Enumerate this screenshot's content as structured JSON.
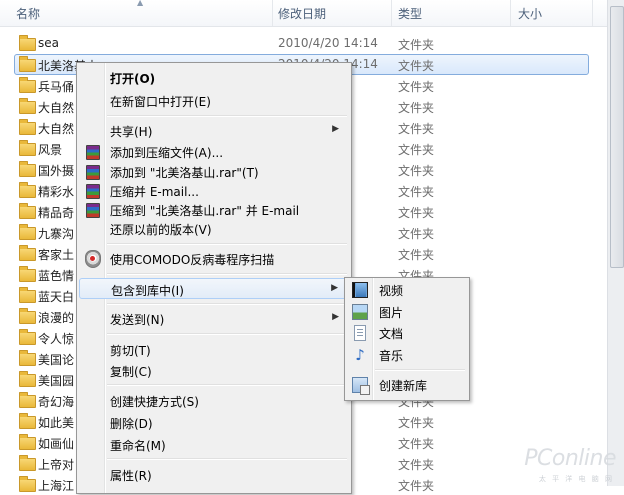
{
  "header": {
    "columns": [
      "名称",
      "修改日期",
      "类型",
      "大小"
    ]
  },
  "files": [
    {
      "name": "sea",
      "date": "2010/4/20 14:14",
      "type": "文件夹",
      "selected": false
    },
    {
      "name": "北美洛基山",
      "date": "2010/4/20 14:14",
      "type": "文件夹",
      "selected": true
    },
    {
      "name": "兵马俑",
      "date": "14:14",
      "type": "文件夹",
      "selected": false
    },
    {
      "name": "大自然",
      "date": "14:14",
      "type": "文件夹",
      "selected": false
    },
    {
      "name": "大自然",
      "date": "8:07",
      "type": "文件夹",
      "selected": false
    },
    {
      "name": "风景",
      "date": "14:14",
      "type": "文件夹",
      "selected": false
    },
    {
      "name": "国外摄",
      "date": "14:14",
      "type": "文件夹",
      "selected": false
    },
    {
      "name": "精彩水",
      "date": "14:14",
      "type": "文件夹",
      "selected": false
    },
    {
      "name": "精品奇",
      "date": "14:14",
      "type": "文件夹",
      "selected": false
    },
    {
      "name": "九寨沟",
      "date": "14:14",
      "type": "文件夹",
      "selected": false
    },
    {
      "name": "客家土",
      "date": "14:14",
      "type": "文件夹",
      "selected": false
    },
    {
      "name": "蓝色情",
      "date": "14:14",
      "type": "文件夹",
      "selected": false
    },
    {
      "name": "蓝天白",
      "date": "14:14",
      "type": "文件夹",
      "selected": false
    },
    {
      "name": "浪漫的",
      "date": "14:14",
      "type": "文件夹",
      "selected": false
    },
    {
      "name": "令人惊",
      "date": "14:14",
      "type": "文件夹",
      "selected": false
    },
    {
      "name": "美国论",
      "date": "14:14",
      "type": "文件夹",
      "selected": false
    },
    {
      "name": "美国园",
      "date": "14:14",
      "type": "文件夹",
      "selected": false
    },
    {
      "name": "奇幻海",
      "date": "14:14",
      "type": "文件夹",
      "selected": false
    },
    {
      "name": "如此美",
      "date": "14:14",
      "type": "文件夹",
      "selected": false
    },
    {
      "name": "如画仙",
      "date": "14:14",
      "type": "文件夹",
      "selected": false
    },
    {
      "name": "上帝对",
      "date": "14:14",
      "type": "文件夹",
      "selected": false
    },
    {
      "name": "上海江",
      "date": "14:14",
      "type": "文件夹",
      "selected": false
    }
  ],
  "context_menu": {
    "open": "打开(O)",
    "open_new_window": "在新窗口中打开(E)",
    "share": "共享(H)",
    "add_to_archive": "添加到压缩文件(A)...",
    "add_to_rar": "添加到 \"北美洛基山.rar\"(T)",
    "compress_email": "压缩并 E-mail...",
    "compress_rar_email": "压缩到 \"北美洛基山.rar\" 并 E-mail",
    "restore_previous": "还原以前的版本(V)",
    "comodo_scan": "使用COMODO反病毒程序扫描",
    "include_in_library": "包含到库中(I)",
    "send_to": "发送到(N)",
    "cut": "剪切(T)",
    "copy": "复制(C)",
    "create_shortcut": "创建快捷方式(S)",
    "delete": "删除(D)",
    "rename": "重命名(M)",
    "properties": "属性(R)"
  },
  "library_submenu": {
    "video": "视频",
    "pictures": "图片",
    "documents": "文档",
    "music": "音乐",
    "new_library": "创建新库"
  },
  "watermark": {
    "brand": "PConline",
    "tagline": "太 平 洋 电 脑 网"
  }
}
